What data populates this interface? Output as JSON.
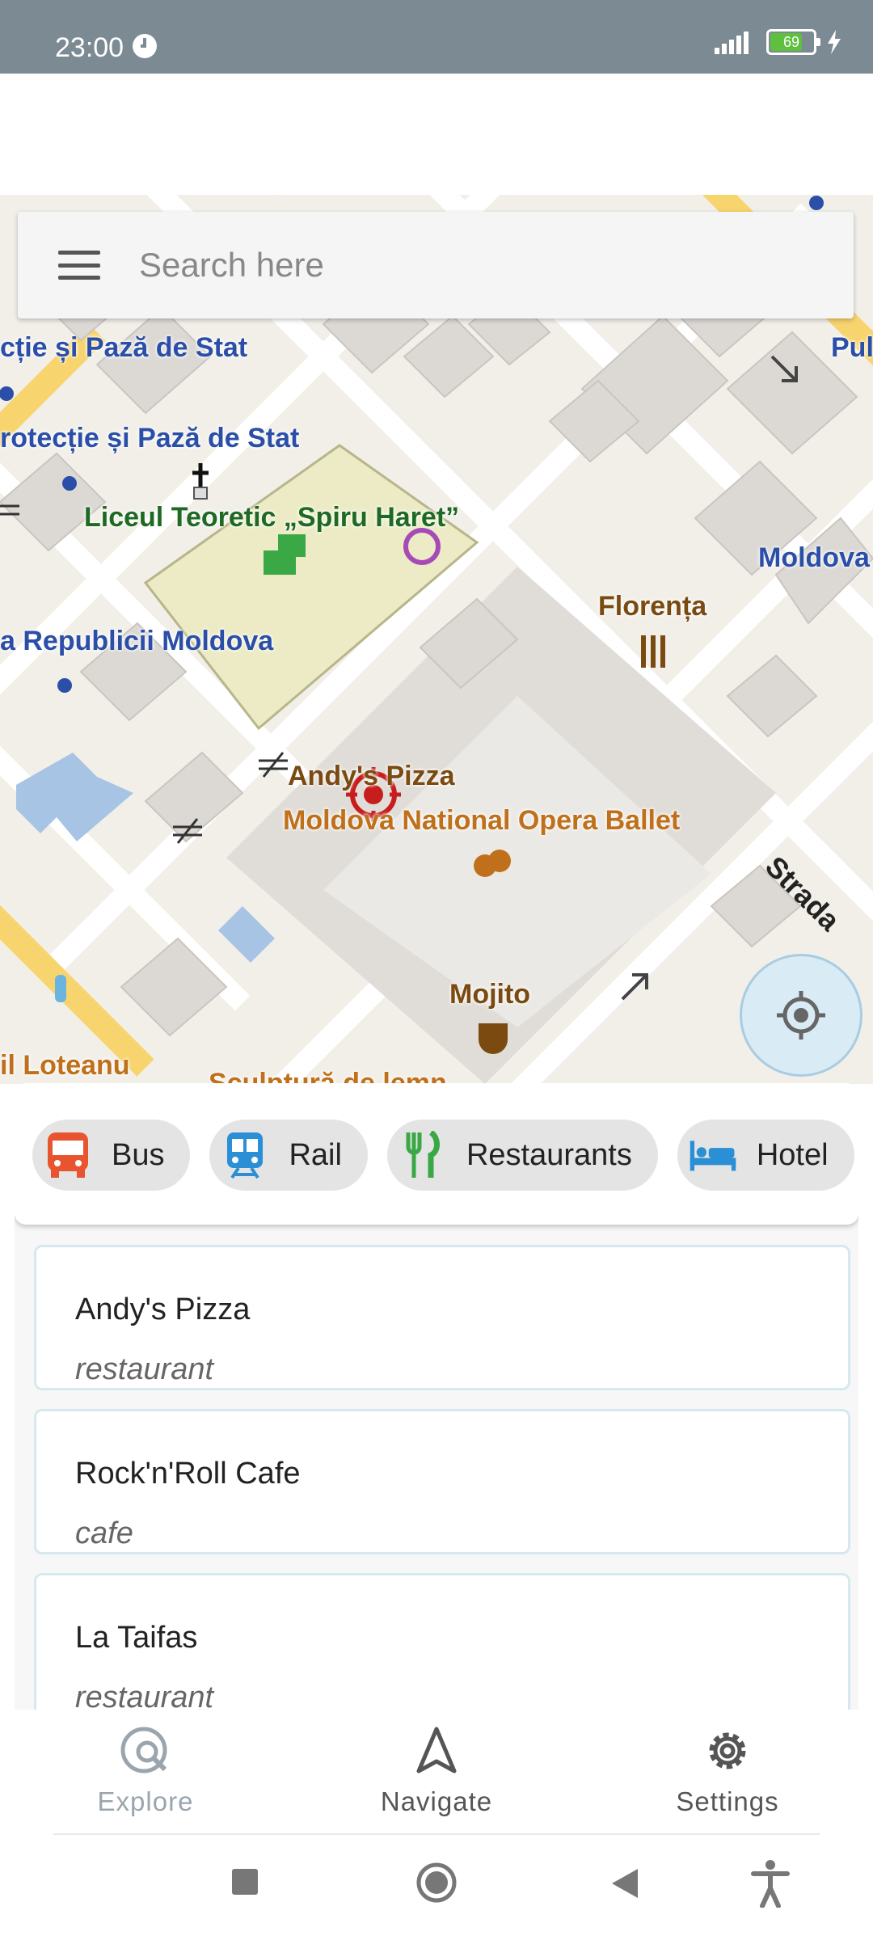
{
  "status_bar": {
    "time": "23:00",
    "battery": "69"
  },
  "search": {
    "placeholder": "Search here"
  },
  "map_labels": {
    "protectie_1": "cție și Pază de Stat",
    "protectie_2": "rotecție și Pază de Stat",
    "liceu": "Liceul Teoretic „Spiru Haret”",
    "republicii": "a Republicii Moldova",
    "florenta": "Florența",
    "andys_pizza": "Andy's Pizza",
    "opera": "Moldova National Opera Ballet",
    "mojito": "Mojito",
    "moldova_right": "Moldova",
    "pul": "Pul",
    "strada": "Strada",
    "loteanu": "il Loteanu",
    "sculptura": "Sculptură de lemn"
  },
  "categories": [
    {
      "label": "Bus",
      "icon": "bus-icon",
      "color": "#e8542f"
    },
    {
      "label": "Rail",
      "icon": "train-icon",
      "color": "#2b8fd6"
    },
    {
      "label": "Restaurants",
      "icon": "fork-knife-icon",
      "color": "#3aa845"
    },
    {
      "label": "Hotel",
      "icon": "bed-icon",
      "color": "#2b8fd6"
    }
  ],
  "results": [
    {
      "name": "Andy's Pizza",
      "type": "restaurant"
    },
    {
      "name": "Rock'n'Roll Cafe",
      "type": "cafe"
    },
    {
      "name": "La Taifas",
      "type": "restaurant"
    }
  ],
  "bottom_nav": {
    "explore": "Explore",
    "navigate": "Navigate",
    "settings": "Settings"
  },
  "colors": {
    "status_bar": "#7b8a93",
    "nav_inactive": "#9aa5ad",
    "nav_active": "#555555"
  }
}
